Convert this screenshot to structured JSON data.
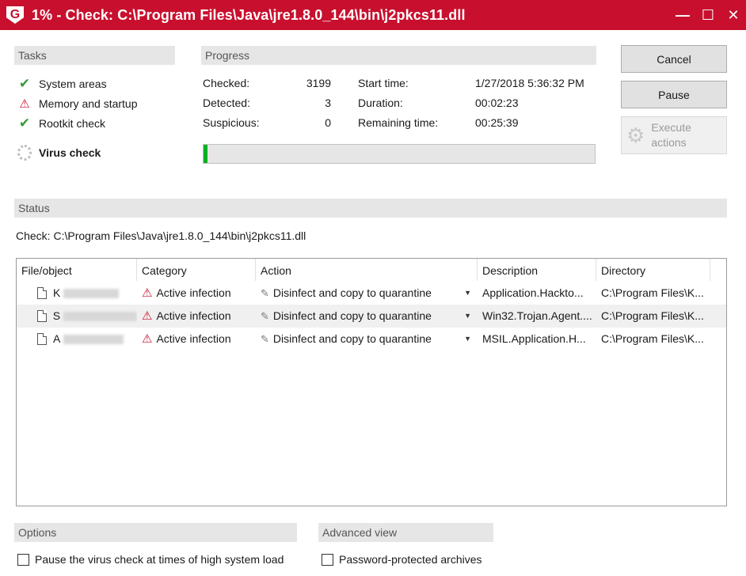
{
  "window": {
    "logo": "G",
    "title": "1% - Check: C:\\Program Files\\Java\\jre1.8.0_144\\bin\\j2pkcs11.dll",
    "minimize": "—",
    "maximize": "☐",
    "close": "✕"
  },
  "tasks": {
    "header": "Tasks",
    "items": [
      {
        "label": "System areas",
        "icon": "check-icon"
      },
      {
        "label": "Memory and startup",
        "icon": "warning-icon"
      },
      {
        "label": "Rootkit check",
        "icon": "check-icon"
      },
      {
        "label": "Virus check",
        "icon": "spinner-icon"
      }
    ]
  },
  "progress": {
    "header": "Progress",
    "checked_label": "Checked:",
    "checked_value": "3199",
    "detected_label": "Detected:",
    "detected_value": "3",
    "suspicious_label": "Suspicious:",
    "suspicious_value": "0",
    "start_label": "Start time:",
    "start_value": "1/27/2018 5:36:32 PM",
    "duration_label": "Duration:",
    "duration_value": "00:02:23",
    "remaining_label": "Remaining time:",
    "remaining_value": "00:25:39",
    "percent": 1
  },
  "buttons": {
    "cancel": "Cancel",
    "pause": "Pause",
    "execute": "Execute actions"
  },
  "status": {
    "header": "Status",
    "path": "Check: C:\\Program Files\\Java\\jre1.8.0_144\\bin\\j2pkcs11.dll"
  },
  "table": {
    "columns": [
      "File/object",
      "Category",
      "Action",
      "Description",
      "Directory"
    ],
    "rows": [
      {
        "file": "K",
        "category": "Active infection",
        "action": "Disinfect and copy to quarantine",
        "description": "Application.Hackto...",
        "directory": "C:\\Program Files\\K..."
      },
      {
        "file": "S",
        "category": "Active infection",
        "action": "Disinfect and copy to quarantine",
        "description": "Win32.Trojan.Agent....",
        "directory": "C:\\Program Files\\K..."
      },
      {
        "file": "A",
        "category": "Active infection",
        "action": "Disinfect and copy to quarantine",
        "description": "MSIL.Application.H...",
        "directory": "C:\\Program Files\\K..."
      }
    ]
  },
  "options": {
    "header": "Options",
    "pause_label": "Pause the virus check at times of high system load"
  },
  "advanced": {
    "header": "Advanced view",
    "password_label": "Password-protected archives"
  },
  "colors": {
    "titlebar": "#c8102e",
    "check": "#3a9a3a",
    "warning": "#c8102e"
  }
}
